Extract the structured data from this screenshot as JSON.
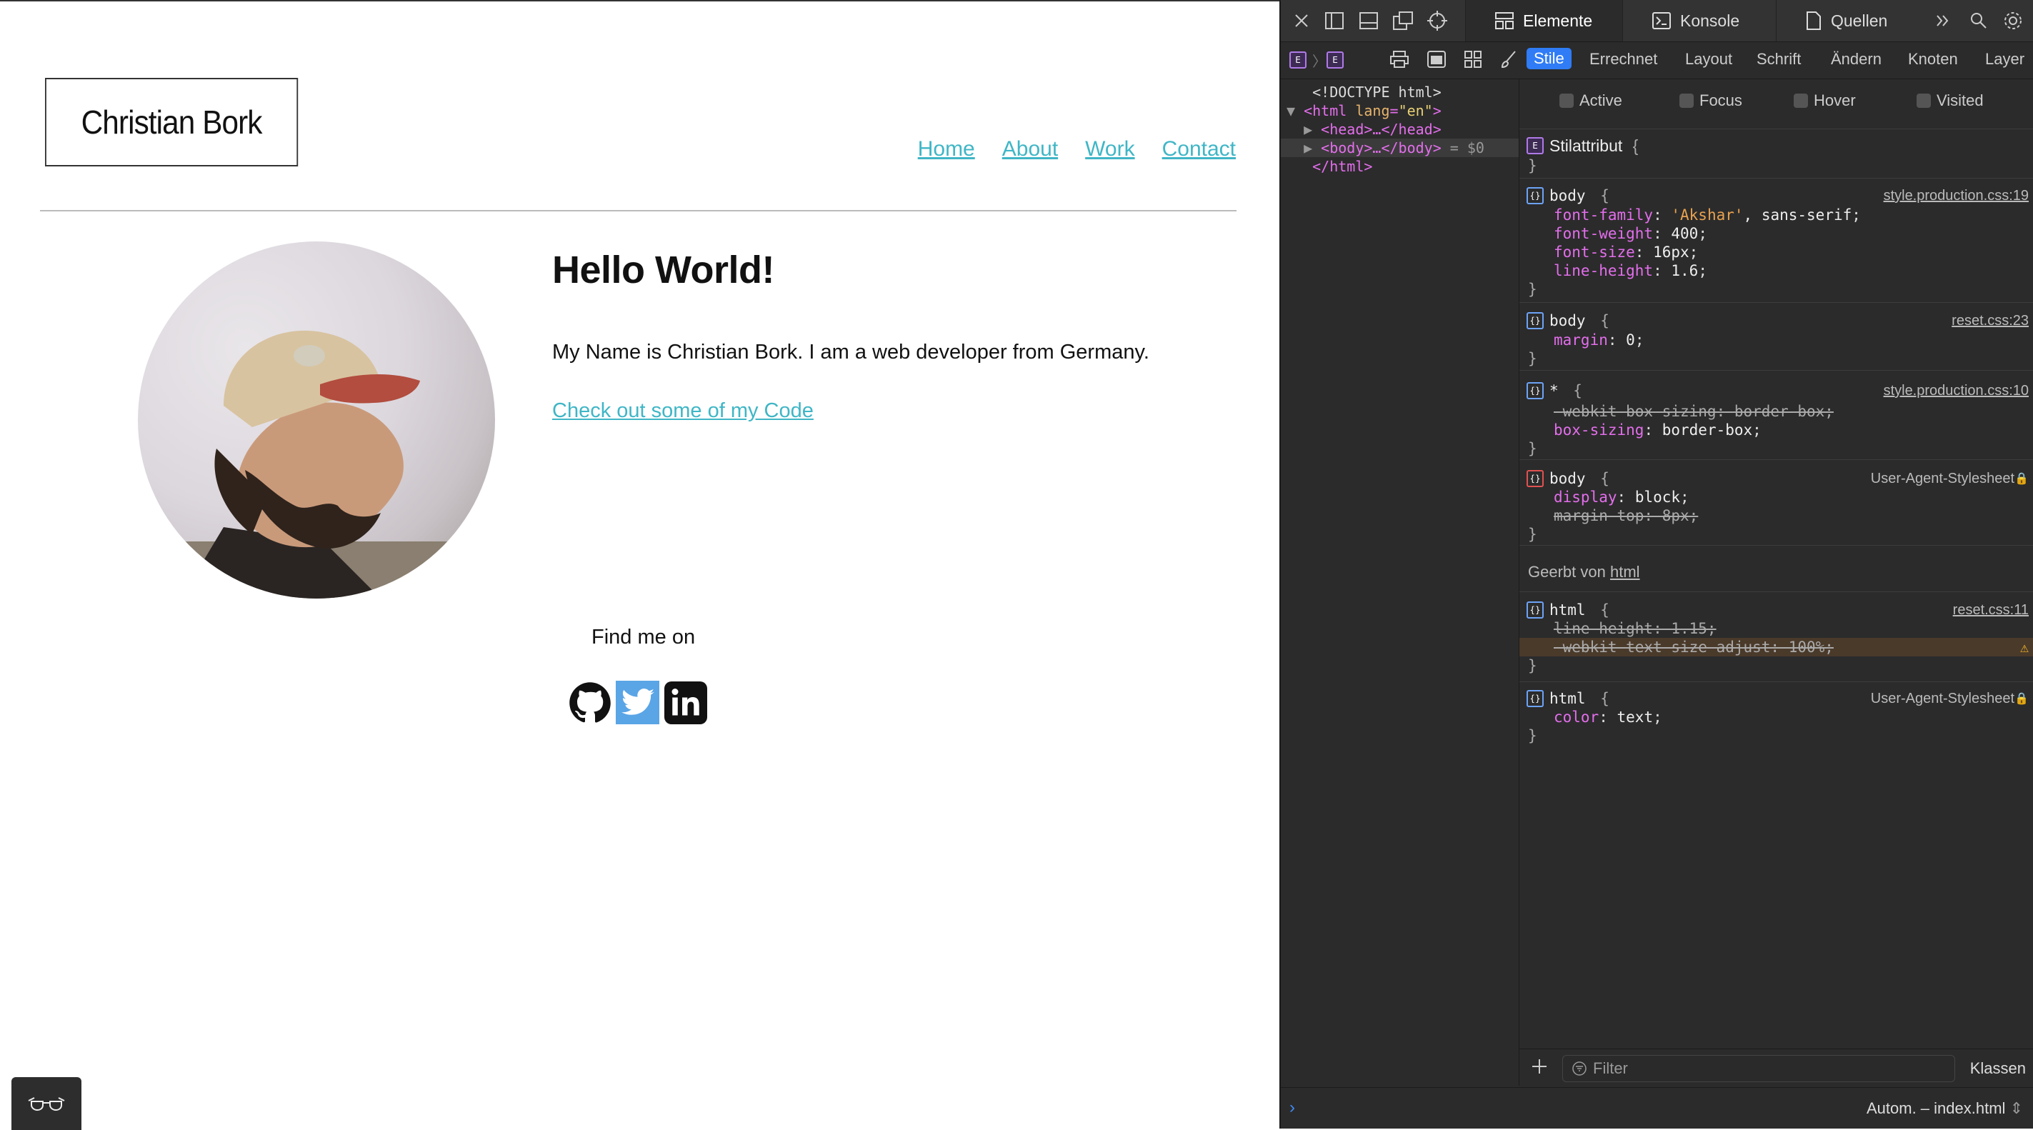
{
  "site": {
    "logo": "Christian Bork",
    "nav": [
      "Home",
      "About",
      "Work",
      "Contact"
    ],
    "heading": "Hello World!",
    "intro": "My Name is Christian Bork. I am a web developer from Germany.",
    "code_link": "Check out some of my Code",
    "find_me": "Find me on",
    "social": [
      "github-icon",
      "twitter-icon",
      "linkedin-icon"
    ]
  },
  "devtools": {
    "tabs": [
      "Elemente",
      "Konsole",
      "Quellen"
    ],
    "subtabs": [
      "Stile",
      "Errechnet",
      "Layout",
      "Schrift",
      "Ändern",
      "Knoten",
      "Layer"
    ],
    "dom": {
      "doctype": "<!DOCTYPE html>",
      "html_open_tag": "<html ",
      "html_attr": "lang",
      "html_attr_value": "\"en\"",
      "head": "<head>…</head>",
      "body": "<body>…</body>",
      "body_ref": " = $0",
      "html_close": "</html>"
    },
    "pseudo": [
      "Active",
      "Focus",
      "Hover",
      "Visited"
    ],
    "style_attr": "Stilattribut",
    "rules": {
      "r1": {
        "selector": "body",
        "source": "style.production.css:19",
        "d1n": "font-family",
        "d1v": "'Akshar'",
        "d1v2": ", sans-serif",
        "d2n": "font-weight",
        "d2v": "400",
        "d3n": "font-size",
        "d3v": "16px",
        "d4n": "line-height",
        "d4v": "1.6"
      },
      "r2": {
        "selector": "body",
        "source": "reset.css:23",
        "d1n": "margin",
        "d1v": "0"
      },
      "r3": {
        "selector": "*",
        "source": "style.production.css:10",
        "d1": "-webkit-box-sizing: border-box;",
        "d2n": "box-sizing",
        "d2v": "border-box"
      },
      "r4": {
        "selector": "body",
        "source": "User-Agent-Stylesheet",
        "d1n": "display",
        "d1v": "block",
        "d2": "margin-top: 8px;"
      },
      "inherited_label": "Geerbt von",
      "inherited_from": "html",
      "r5": {
        "selector": "html",
        "source": "reset.css:11",
        "d1": "line-height: 1.15;",
        "d2": "-webkit-text-size-adjust: 100%;"
      },
      "r6": {
        "selector": "html",
        "source": "User-Agent-Stylesheet",
        "d1n": "color",
        "d1v": "text"
      }
    },
    "filter_placeholder": "Filter",
    "classes_label": "Klassen",
    "context": "Autom. – index.html"
  }
}
